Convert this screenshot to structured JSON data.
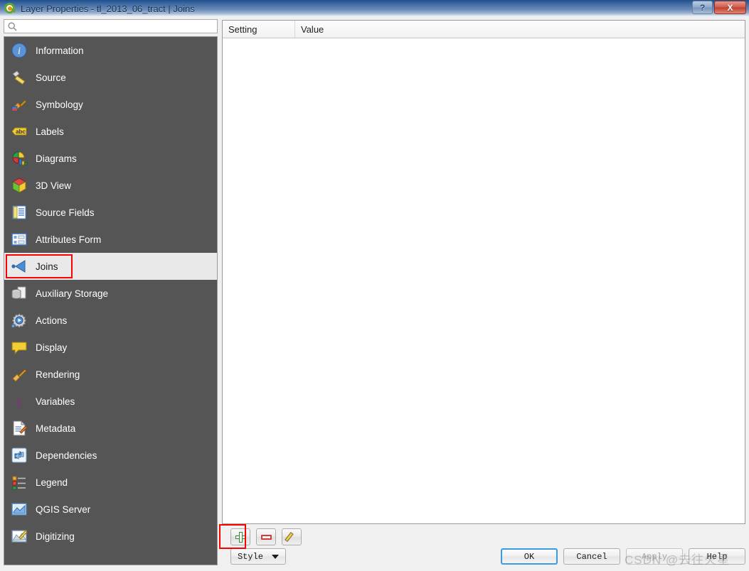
{
  "window": {
    "title": "Layer Properties - tl_2013_06_tract | Joins",
    "logo_icon": "qgis-logo-icon",
    "help_button_label": "?",
    "close_button_label": "X"
  },
  "sidebar": {
    "search": {
      "value": "",
      "placeholder": "",
      "icon": "search-icon"
    },
    "items": [
      {
        "label": "Information",
        "icon": "information-icon",
        "selected": false
      },
      {
        "label": "Source",
        "icon": "source-icon",
        "selected": false
      },
      {
        "label": "Symbology",
        "icon": "symbology-icon",
        "selected": false
      },
      {
        "label": "Labels",
        "icon": "labels-icon",
        "selected": false
      },
      {
        "label": "Diagrams",
        "icon": "diagrams-icon",
        "selected": false
      },
      {
        "label": "3D View",
        "icon": "3d-view-icon",
        "selected": false
      },
      {
        "label": "Source Fields",
        "icon": "source-fields-icon",
        "selected": false
      },
      {
        "label": "Attributes Form",
        "icon": "attributes-form-icon",
        "selected": false
      },
      {
        "label": "Joins",
        "icon": "joins-icon",
        "selected": true
      },
      {
        "label": "Auxiliary Storage",
        "icon": "auxiliary-storage-icon",
        "selected": false
      },
      {
        "label": "Actions",
        "icon": "actions-icon",
        "selected": false
      },
      {
        "label": "Display",
        "icon": "display-icon",
        "selected": false
      },
      {
        "label": "Rendering",
        "icon": "rendering-icon",
        "selected": false
      },
      {
        "label": "Variables",
        "icon": "variables-icon",
        "selected": false
      },
      {
        "label": "Metadata",
        "icon": "metadata-icon",
        "selected": false
      },
      {
        "label": "Dependencies",
        "icon": "dependencies-icon",
        "selected": false
      },
      {
        "label": "Legend",
        "icon": "legend-icon",
        "selected": false
      },
      {
        "label": "QGIS Server",
        "icon": "qgis-server-icon",
        "selected": false
      },
      {
        "label": "Digitizing",
        "icon": "digitizing-icon",
        "selected": false
      }
    ]
  },
  "main": {
    "table": {
      "columns": [
        "Setting",
        "Value"
      ],
      "rows": []
    },
    "toolbar": {
      "add_label": "",
      "remove_label": "",
      "edit_label": "",
      "add_icon": "add-plus-icon",
      "remove_icon": "remove-minus-icon",
      "edit_icon": "edit-pencil-icon"
    },
    "style_button": {
      "label": "Style",
      "caret_icon": "chevron-down-icon"
    },
    "dialog_buttons": [
      {
        "label": "OK",
        "state": "default"
      },
      {
        "label": "Cancel",
        "state": "normal"
      },
      {
        "label": "Apply",
        "state": "disabled"
      },
      {
        "label": "Help",
        "state": "normal"
      }
    ]
  },
  "annotations": {
    "joins_highlight": "red-rectangle-joins",
    "add_button_highlight": "red-rectangle-add-button"
  },
  "watermark": {
    "text": "CSDN @去往火星"
  },
  "colors": {
    "sidebar_bg": "#555555",
    "sidebar_selected_bg": "#e9e9e9",
    "annotation_red": "#ff0000",
    "titlebar_blue": "#39659e",
    "default_button_blue": "#3c9ade"
  }
}
